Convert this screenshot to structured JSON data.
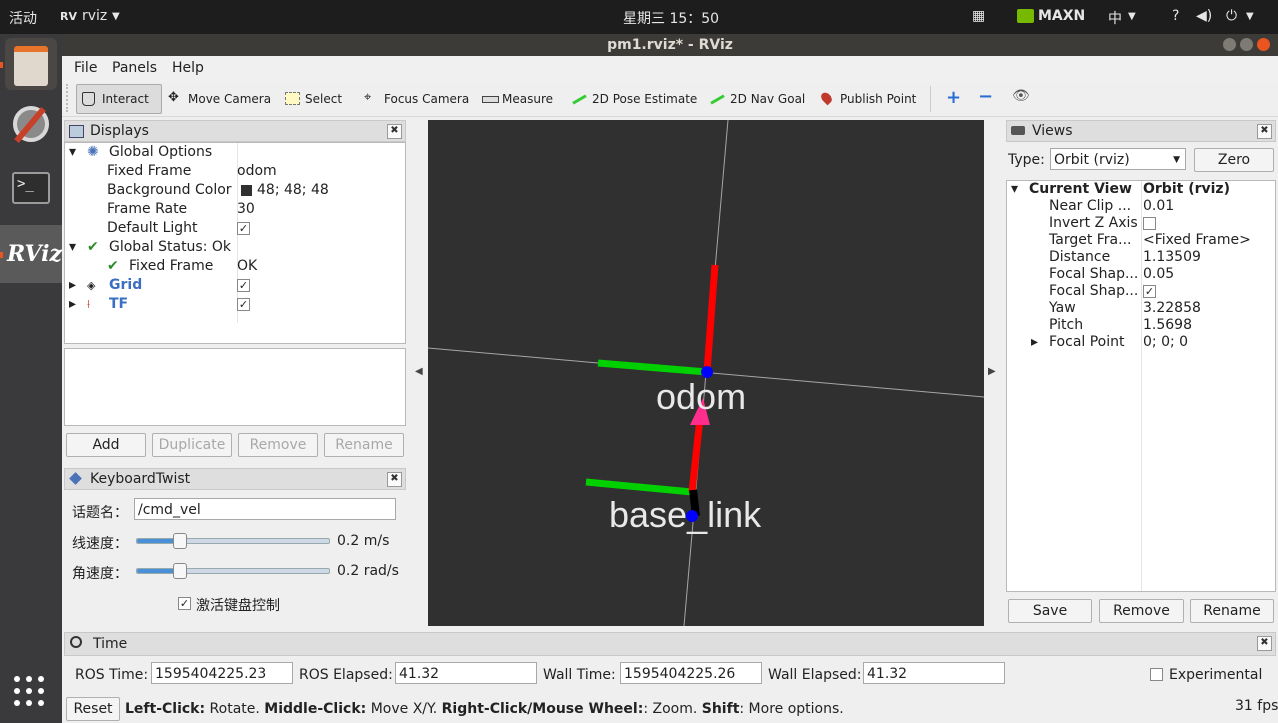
{
  "topbar": {
    "activities": "活动",
    "app_menu": "rviz",
    "clock": "星期三 15：50",
    "power_mode": "MAXN",
    "input_method": "中"
  },
  "window": {
    "title": "pm1.rviz* - RViz"
  },
  "menu": {
    "file": "File",
    "panels": "Panels",
    "help": "Help"
  },
  "toolbar": {
    "interact": "Interact",
    "move_camera": "Move Camera",
    "select": "Select",
    "focus_camera": "Focus Camera",
    "measure": "Measure",
    "pose_estimate": "2D Pose Estimate",
    "nav_goal": "2D Nav Goal",
    "publish_point": "Publish Point"
  },
  "displays": {
    "title": "Displays",
    "global_options": "Global Options",
    "fixed_frame_label": "Fixed Frame",
    "fixed_frame_value": "odom",
    "bg_color_label": "Background Color",
    "bg_color_value": "48; 48; 48",
    "bg_color_swatch": "#303030",
    "frame_rate_label": "Frame Rate",
    "frame_rate_value": "30",
    "default_light_label": "Default Light",
    "global_status_label": "Global Status: Ok",
    "status_fixed_frame_label": "Fixed Frame",
    "status_fixed_frame_value": "OK",
    "grid_label": "Grid",
    "tf_label": "TF",
    "add": "Add",
    "duplicate": "Duplicate",
    "remove": "Remove",
    "rename": "Rename"
  },
  "keyboard": {
    "title": "KeyboardTwist",
    "topic_label": "话题名：",
    "topic_value": "/cmd_vel",
    "linear_label": "线速度：",
    "linear_value": "0.2 m/s",
    "linear_level": 0.22,
    "angular_label": "角速度：",
    "angular_value": "0.2 rad/s",
    "angular_level": 0.22,
    "activate_label": "激活键盘控制"
  },
  "viewport": {
    "label_odom": "odom",
    "label_base": "base_link"
  },
  "views": {
    "title": "Views",
    "type_label": "Type:",
    "type_value": "Orbit (rviz)",
    "zero": "Zero",
    "current_view": "Current View",
    "current_view_value": "Orbit (rviz)",
    "props": [
      {
        "k": "Near Clip ...",
        "v": "0.01"
      },
      {
        "k": "Invert Z Axis",
        "v": ""
      },
      {
        "k": "Target Fra...",
        "v": "<Fixed Frame>"
      },
      {
        "k": "Distance",
        "v": "1.13509"
      },
      {
        "k": "Focal Shap...",
        "v": "0.05"
      },
      {
        "k": "Focal Shap...",
        "v": ""
      },
      {
        "k": "Yaw",
        "v": "3.22858"
      },
      {
        "k": "Pitch",
        "v": "1.5698"
      },
      {
        "k": "Focal Point",
        "v": "0; 0; 0"
      }
    ],
    "save": "Save",
    "remove": "Remove",
    "rename": "Rename"
  },
  "time": {
    "title": "Time",
    "ros_time_label": "ROS Time:",
    "ros_time": "1595404225.23",
    "ros_elapsed_label": "ROS Elapsed:",
    "ros_elapsed": "41.32",
    "wall_time_label": "Wall Time:",
    "wall_time": "1595404225.26",
    "wall_elapsed_label": "Wall Elapsed:",
    "wall_elapsed": "41.32",
    "experimental": "Experimental"
  },
  "status": {
    "reset": "Reset",
    "lc": "Left-Click:",
    "lc_t": " Rotate. ",
    "mc": "Middle-Click:",
    "mc_t": " Move X/Y. ",
    "rc": "Right-Click/Mouse Wheel:",
    "rc_t": ": Zoom. ",
    "sh": "Shift",
    "sh_t": ": More options.",
    "fps": "31 fps"
  },
  "colors": {
    "x_axis": "#ff0000",
    "y_axis": "#00cc00",
    "origin": "#0000ff",
    "arrow": "#ff2d8c"
  }
}
